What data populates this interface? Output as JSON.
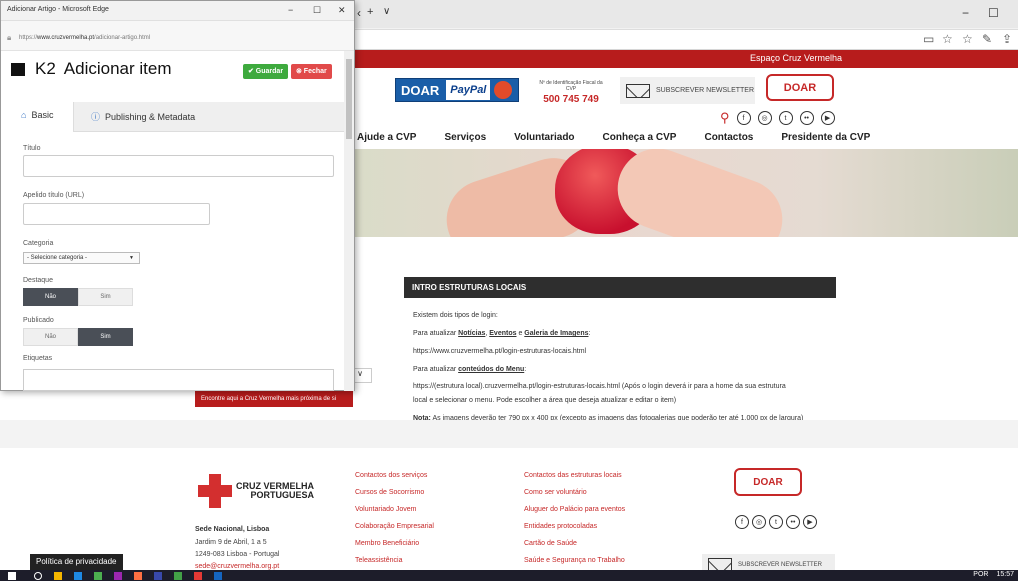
{
  "browser": {
    "tab_add": "+",
    "tab_menu": "∨",
    "controls": {
      "minimize": "−",
      "maximize": "☐",
      "close": "✕"
    },
    "toolbar_icons": [
      "reading-view-icon",
      "favorite-star-icon",
      "favorites-icon",
      "pen-icon",
      "share-icon"
    ]
  },
  "dialog": {
    "window_title": "Adicionar Artigo - Microsoft Edge",
    "url_prefix": "https://",
    "url_domain": "www.cruzvermelha.pt",
    "url_path": "/adicionar-artigo.html",
    "heading": "Adicionar item",
    "logo_text": "K2",
    "save_label": "✔ Guardar",
    "close_label": "⊗ Fechar",
    "tabs": [
      {
        "label": "Basic",
        "icon": "home-icon"
      },
      {
        "label": "Publishing & Metadata",
        "icon": "info-icon"
      }
    ],
    "fields": {
      "titulo": "Título",
      "apelido": "Apelido título (URL)",
      "categoria": "Categoria",
      "categoria_value": "- Selecione categoria -",
      "destaque": "Destaque",
      "publicado": "Publicado",
      "etiquetas": "Etiquetas"
    },
    "toggle_no": "Não",
    "toggle_yes": "Sim",
    "destaque_selected": "Não",
    "publicado_selected": "Sim"
  },
  "site": {
    "top_strip": "Espaço Cruz Vermelha",
    "doar_small": "DOAR",
    "paypal": "PayPal",
    "nif_label": "Nº de Identificação Fiscal da CVP",
    "nif_phone": "500 745 749",
    "newsletter": "SUBSCREVER NEWSLETTER",
    "doar": "DOAR",
    "social_icons": [
      "search-icon",
      "facebook-icon",
      "instagram-icon",
      "twitter-icon",
      "flickr-icon",
      "youtube-icon"
    ],
    "nav": [
      "Ajude a CVP",
      "Serviços",
      "Voluntariado",
      "Conheça a CVP",
      "Contactos",
      "Presidente da CVP"
    ],
    "intro_title": "INTRO ESTRUTURAS LOCAIS",
    "intro_lines": {
      "l1": "Existem dois tipos de login:",
      "l2a": "Para atualizar ",
      "l2b": "Notícias",
      "l2c": ", ",
      "l2d": "Eventos",
      "l2e": " e ",
      "l2f": "Galeria de Imagens",
      "l2g": ":",
      "l3": "https://www.cruzvermelha.pt/login-estruturas-locais.html",
      "l4a": "Para atualizar ",
      "l4b": "conteúdos do Menu",
      "l4c": ":",
      "l5": "https://(estrutura local).cruzvermelha.pt/login-estruturas-locais.html (Após o login deverá ir para a home da sua estrutura",
      "l6": "local e selecionar o menu. Pode escolher a área que deseja atualizar e editar o item)",
      "l7a": "Nota:",
      "l7b": " As imagens deverão ter 790 px x 400 px (excepto as imagens das fotogalerias que poderão ter até 1.000 px de largura)"
    },
    "red_box_text": "Encontre aqui a Cruz Vermelha mais próxima de si",
    "footer": {
      "logo_line1": "CRUZ VERMELHA",
      "logo_line2": "PORTUGUESA",
      "sede": "Sede Nacional, Lisboa",
      "addr1": "Jardim 9 de Abril, 1 a 5",
      "addr2": "1249-083 Lisboa - Portugal",
      "email": "sede@cruzvermelha.org.pt",
      "col1": [
        "Contactos dos serviços",
        "Cursos de Socorrismo",
        "Voluntariado Jovem",
        "Colaboração Empresarial",
        "Membro Beneficiário",
        "Teleassistência"
      ],
      "col2": [
        "Contactos das estruturas locais",
        "Como ser voluntário",
        "Aluguer do Palácio para eventos",
        "Entidades protocoladas",
        "Cartão de Saúde",
        "Saúde e Segurança no Trabalho"
      ],
      "doar": "DOAR",
      "newsletter": "SUBSCREVER NEWSLETTER"
    },
    "privacy": "Política de privacidade"
  },
  "taskbar": {
    "lang": "POR",
    "time": "15:57"
  }
}
